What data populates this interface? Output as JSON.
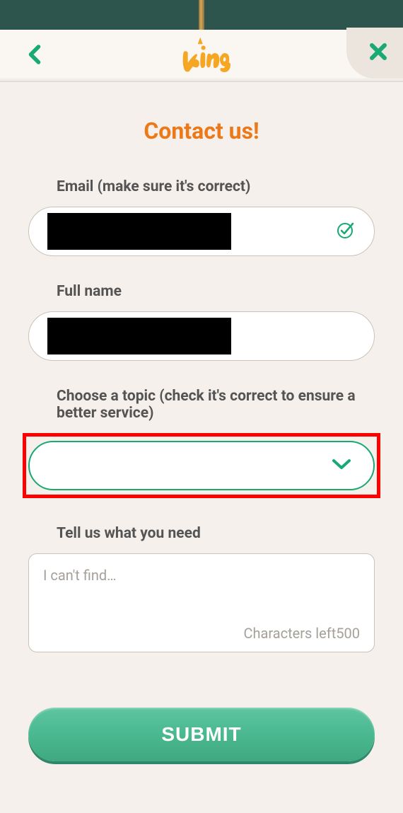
{
  "header": {
    "logo_name": "King"
  },
  "page": {
    "title": "Contact us!"
  },
  "form": {
    "email": {
      "label": "Email (make sure it's correct)",
      "value": ""
    },
    "fullname": {
      "label": "Full name",
      "value": ""
    },
    "topic": {
      "label": "Choose a topic (check it's correct to ensure a better service)",
      "value": ""
    },
    "message": {
      "label": "Tell us what you need",
      "placeholder": "I can't find…",
      "value": "",
      "char_counter_prefix": "Characters left",
      "char_counter_value": "500"
    },
    "submit_label": "SUBMIT"
  }
}
